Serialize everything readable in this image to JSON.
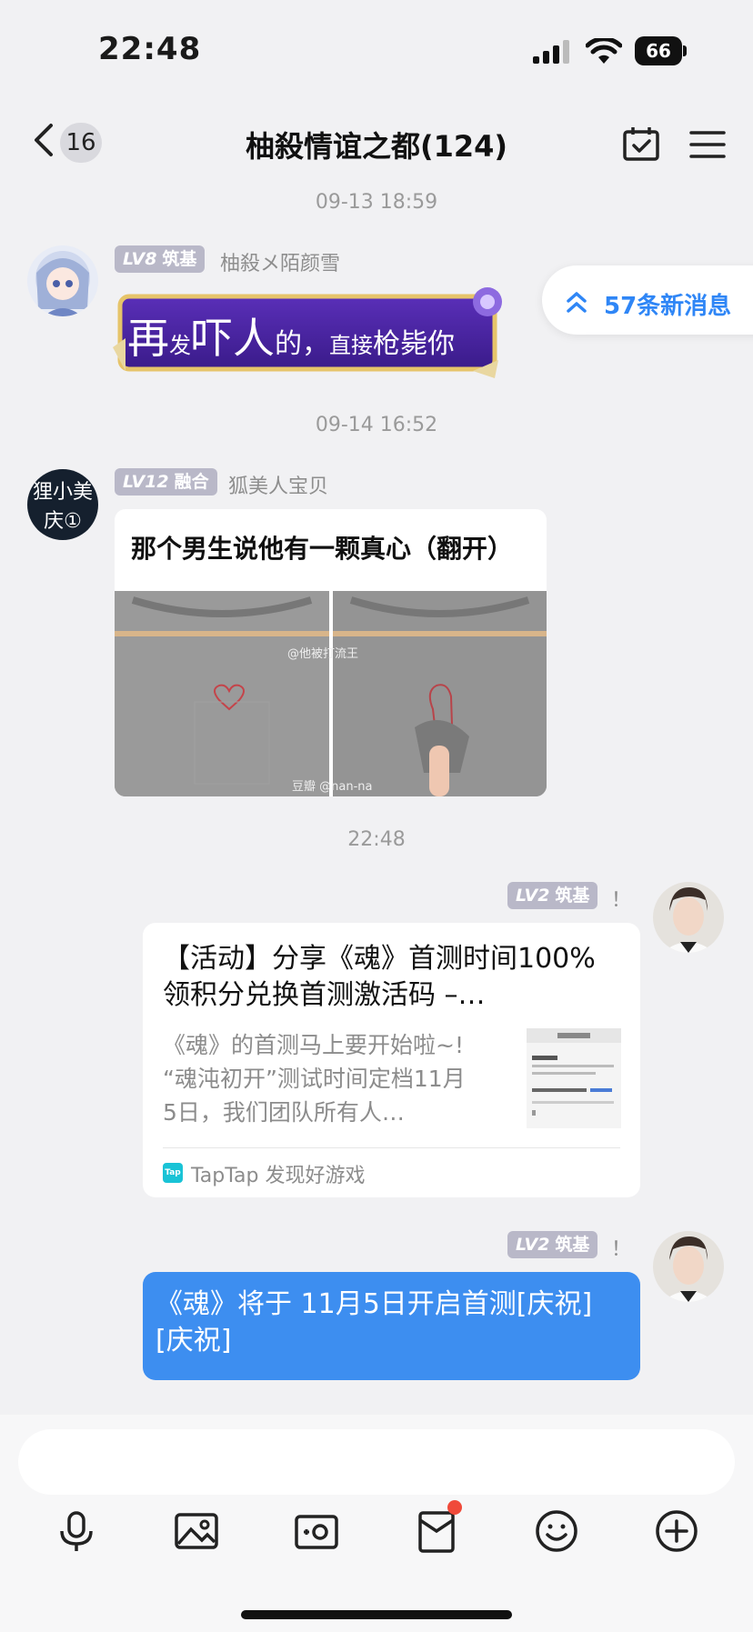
{
  "status_bar": {
    "time": "22:48",
    "battery": "66"
  },
  "header": {
    "unread_count": "16",
    "title": "柚殺情谊之都(124)"
  },
  "new_messages": {
    "label": "57条新消息"
  },
  "messages": [
    {
      "timestamp": "09-13 18:59",
      "level": "LV8",
      "rank": "筑基",
      "sender": "柚殺メ陌颜雪",
      "sticker_text": [
        "再",
        "发",
        "吓人",
        "的，",
        "直接",
        "枪毙",
        "你"
      ]
    },
    {
      "timestamp": "09-14 16:52",
      "level": "LV12",
      "rank": "融合",
      "sender": "狐美人宝贝",
      "avatar_text": "狸小美庆①",
      "meme_caption": "那个男生说他有一颗真心（翻开）",
      "meme_watermark_1": "@他被打流王",
      "meme_watermark_2": "豆瓣 @nan-na"
    },
    {
      "timestamp": "22:48",
      "level": "LV2",
      "rank": "筑基",
      "sender": "！",
      "link_title": "【活动】分享《魂》首测时间100%领积分兑换首测激活码 –…",
      "link_desc": "《魂》的首测马上要开始啦~! “魂沌初开”测试时间定档11月5日，我们团队所有人…",
      "link_source": "TapTap 发现好游戏",
      "link_source_icon": "Tap"
    },
    {
      "level": "LV2",
      "rank": "筑基",
      "sender": "！",
      "text": "《魂》将于 11月5日开启首测[庆祝][庆祝]"
    }
  ],
  "input": {
    "placeholder": ""
  },
  "toolbar": [
    "mic-icon",
    "photo-icon",
    "camera-icon",
    "redpacket-icon",
    "emoji-icon",
    "plus-icon"
  ],
  "colors": {
    "accent": "#2f86f6",
    "bubble": "#3d8ef0",
    "badge": "#b9b8c8",
    "notification_dot": "#f04a3a"
  }
}
